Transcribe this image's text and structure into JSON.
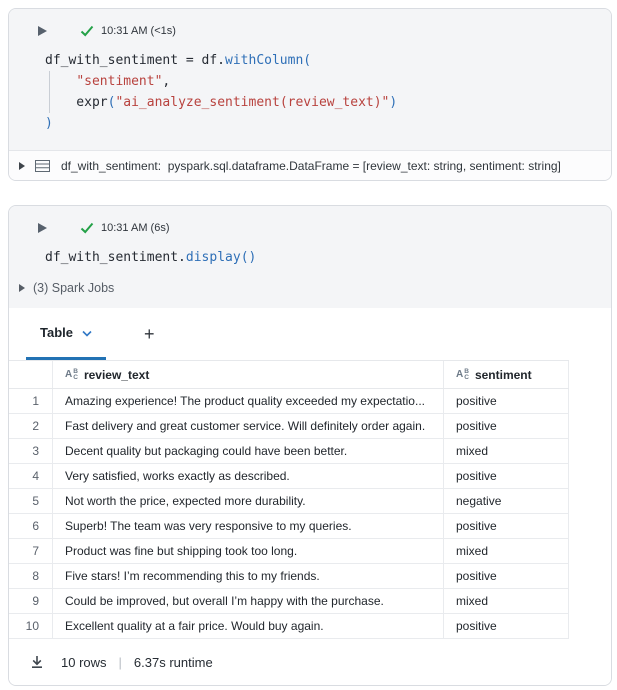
{
  "colors": {
    "accent_blue": "#2272b4",
    "function_blue": "#2e6fb7",
    "string_red": "#b8423e",
    "success_green": "#24a148",
    "gray_cell_bg": "#f4f5f7"
  },
  "icons": {
    "string_type": {
      "a": "A",
      "b": "B",
      "c": "C"
    }
  },
  "cell1": {
    "run_time": "10:31 AM (<1s)",
    "code_lines": [
      {
        "guide": false,
        "tokens": [
          {
            "t": "df_with_sentiment = df.",
            "c": "plain"
          },
          {
            "t": "withColumn",
            "c": "fn"
          },
          {
            "t": "(",
            "c": "brk"
          }
        ]
      },
      {
        "guide": true,
        "tokens": [
          {
            "t": "    ",
            "c": "plain"
          },
          {
            "t": "\"sentiment\"",
            "c": "str"
          },
          {
            "t": ",",
            "c": "plain"
          }
        ]
      },
      {
        "guide": true,
        "tokens": [
          {
            "t": "    expr",
            "c": "plain"
          },
          {
            "t": "(",
            "c": "brk"
          },
          {
            "t": "\"ai_analyze_sentiment(review_text)\"",
            "c": "str"
          },
          {
            "t": ")",
            "c": "brk"
          }
        ]
      },
      {
        "guide": false,
        "tokens": [
          {
            "t": ")",
            "c": "brk"
          }
        ]
      }
    ],
    "output_text": "df_with_sentiment:  pyspark.sql.dataframe.DataFrame = [review_text: string, sentiment: string]"
  },
  "cell2": {
    "run_time": "10:31 AM (6s)",
    "code_lines": [
      {
        "guide": false,
        "tokens": [
          {
            "t": "df_with_sentiment.",
            "c": "plain"
          },
          {
            "t": "display",
            "c": "fn"
          },
          {
            "t": "(",
            "c": "brk"
          },
          {
            "t": ")",
            "c": "brk"
          }
        ]
      }
    ],
    "spark_jobs_label": "(3) Spark Jobs",
    "results": {
      "active_tab": "Table",
      "add_tab_label": "+",
      "columns": [
        {
          "label": "review_text",
          "type": "string"
        },
        {
          "label": "sentiment",
          "type": "string"
        }
      ],
      "rows": [
        {
          "num": "1",
          "review_text": "Amazing experience! The product quality exceeded my expectatio...",
          "sentiment": "positive"
        },
        {
          "num": "2",
          "review_text": "Fast delivery and great customer service. Will definitely order again.",
          "sentiment": "positive"
        },
        {
          "num": "3",
          "review_text": "Decent quality but packaging could have been better.",
          "sentiment": "mixed"
        },
        {
          "num": "4",
          "review_text": "Very satisfied, works exactly as described.",
          "sentiment": "positive"
        },
        {
          "num": "5",
          "review_text": "Not worth the price, expected more durability.",
          "sentiment": "negative"
        },
        {
          "num": "6",
          "review_text": "Superb! The team was very responsive to my queries.",
          "sentiment": "positive"
        },
        {
          "num": "7",
          "review_text": "Product was fine but shipping took too long.",
          "sentiment": "mixed"
        },
        {
          "num": "8",
          "review_text": "Five stars! I’m recommending this to my friends.",
          "sentiment": "positive"
        },
        {
          "num": "9",
          "review_text": "Could be improved, but overall I’m happy with the purchase.",
          "sentiment": "mixed"
        },
        {
          "num": "10",
          "review_text": "Excellent quality at a fair price. Would buy again.",
          "sentiment": "positive"
        }
      ],
      "footer": {
        "row_count": "10 rows",
        "separator": "|",
        "runtime": "6.37s runtime"
      }
    }
  }
}
